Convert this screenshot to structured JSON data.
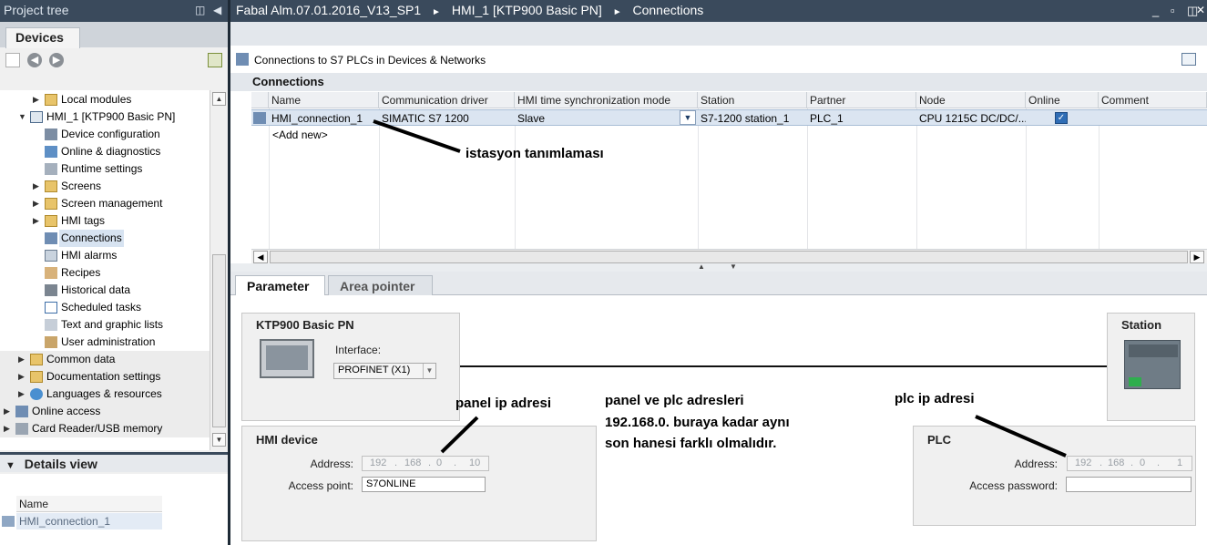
{
  "left_panel": {
    "title": "Project tree",
    "tab": "Devices",
    "tree": [
      {
        "label": "Local modules",
        "icon": "folder-icon"
      },
      {
        "label": "HMI_1 [KTP900 Basic PN]",
        "icon": "hmi-device-icon"
      },
      {
        "label": "Device configuration",
        "icon": "device-config-icon"
      },
      {
        "label": "Online & diagnostics",
        "icon": "diagnostics-icon"
      },
      {
        "label": "Runtime settings",
        "icon": "runtime-settings-icon"
      },
      {
        "label": "Screens",
        "icon": "folder-icon"
      },
      {
        "label": "Screen management",
        "icon": "screen-management-icon"
      },
      {
        "label": "HMI tags",
        "icon": "tags-icon"
      },
      {
        "label": "Connections",
        "icon": "connections-icon"
      },
      {
        "label": "HMI alarms",
        "icon": "alarms-icon"
      },
      {
        "label": "Recipes",
        "icon": "recipes-icon"
      },
      {
        "label": "Historical data",
        "icon": "historical-data-icon"
      },
      {
        "label": "Scheduled tasks",
        "icon": "scheduled-tasks-icon"
      },
      {
        "label": "Text and graphic lists",
        "icon": "text-lists-icon"
      },
      {
        "label": "User administration",
        "icon": "user-admin-icon"
      },
      {
        "label": "Common data",
        "icon": "common-data-icon"
      },
      {
        "label": "Documentation settings",
        "icon": "documentation-icon"
      },
      {
        "label": "Languages & resources",
        "icon": "languages-icon"
      },
      {
        "label": "Online access",
        "icon": "online-access-icon"
      },
      {
        "label": "Card Reader/USB memory",
        "icon": "card-reader-icon"
      }
    ],
    "details_view": {
      "title": "Details view",
      "column": "Name",
      "row": "HMI_connection_1"
    }
  },
  "header": {
    "breadcrumb": [
      "Fabal Alm.07.01.2016_V13_SP1",
      "HMI_1 [KTP900 Basic PN]",
      "Connections"
    ],
    "separator": "►"
  },
  "editor": {
    "toolbar_label": "Connections to S7 PLCs in Devices & Networks",
    "section_title": "Connections",
    "columns": [
      "Name",
      "Communication driver",
      "HMI time synchronization mode",
      "Station",
      "Partner",
      "Node",
      "Online",
      "Comment"
    ],
    "rows": [
      {
        "name": "HMI_connection_1",
        "driver": "SIMATIC S7 1200",
        "sync_mode": "Slave",
        "station": "S7-1200 station_1",
        "partner": "PLC_1",
        "node": "CPU 1215C DC/DC/...",
        "online": true,
        "comment": ""
      }
    ],
    "add_new": "<Add new>"
  },
  "param_tabs": [
    "Parameter",
    "Area pointer"
  ],
  "parameters": {
    "hmi_box_title": "KTP900 Basic PN",
    "interface_label": "Interface:",
    "interface_value": "PROFINET (X1)",
    "station_title": "Station",
    "hmi_device": {
      "title": "HMI device",
      "address_label": "Address:",
      "address": [
        "192",
        "168",
        "0",
        "10"
      ],
      "access_point_label": "Access point:",
      "access_point": "S7ONLINE"
    },
    "plc": {
      "title": "PLC",
      "address_label": "Address:",
      "address": [
        "192",
        "168",
        "0",
        "1"
      ],
      "password_label": "Access password:",
      "password": ""
    }
  },
  "annotations": {
    "station": "istasyon tanımlaması",
    "panel_ip": "panel ip adresi",
    "note_line1": "panel ve plc adresleri",
    "note_line2": "192.168.0. buraya kadar aynı",
    "note_line3": "son hanesi farklı olmalıdır.",
    "plc_ip": "plc ip adresi"
  },
  "colors": {
    "title_bar": "#3a4a5c",
    "selection": "#dbe5f1",
    "panel_bg": "#f0f0f0"
  }
}
